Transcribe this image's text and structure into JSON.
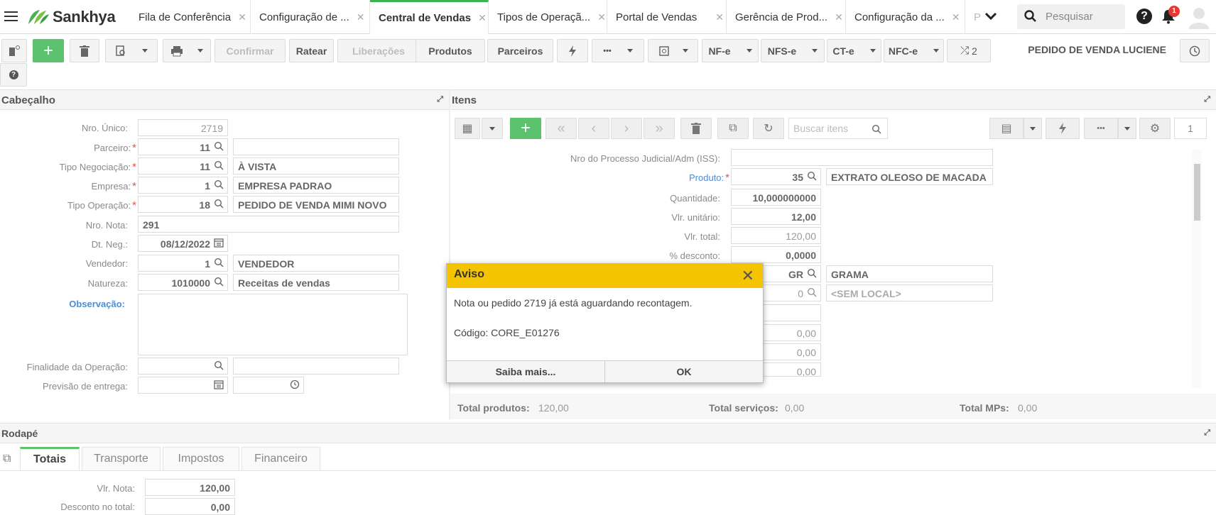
{
  "topbar": {
    "brand": "Sankhya",
    "tabs": [
      {
        "label": "Fila de Conferência",
        "active": false
      },
      {
        "label": "Configuração de ...",
        "active": false
      },
      {
        "label": "Central de Vendas",
        "active": true
      },
      {
        "label": "Tipos de Operaçã...",
        "active": false
      },
      {
        "label": "Portal de Vendas",
        "active": false
      },
      {
        "label": "Gerência de Prod...",
        "active": false
      },
      {
        "label": "Configuração da ...",
        "active": false
      },
      {
        "label": "P",
        "active": false
      }
    ],
    "search_placeholder": "Pesquisar",
    "notification_count": "1"
  },
  "toolbar": {
    "confirmar": "Confirmar",
    "ratear": "Ratear",
    "liberacoes": "Liberações",
    "produtos": "Produtos",
    "parceiros": "Parceiros",
    "more": "•••",
    "nfe": "NF-e",
    "nfse": "NFS-e",
    "cte": "CT-e",
    "nfce": "NFC-e",
    "shuffle_count": "2",
    "order_name": "PEDIDO DE VENDA LUCIENE"
  },
  "cabecalho": {
    "title": "Cabeçalho",
    "fields": {
      "nro_unico": {
        "label": "Nro. Único:",
        "value": "2719"
      },
      "parceiro": {
        "label": "Parceiro:",
        "code": "11",
        "desc": ""
      },
      "tipo_negociacao": {
        "label": "Tipo Negociação:",
        "code": "11",
        "desc": "À VISTA"
      },
      "empresa": {
        "label": "Empresa:",
        "code": "1",
        "desc": "EMPRESA PADRAO"
      },
      "tipo_operacao": {
        "label": "Tipo Operação:",
        "code": "18",
        "desc": "PEDIDO DE VENDA MIMI NOVO"
      },
      "nro_nota": {
        "label": "Nro. Nota:",
        "value": "291"
      },
      "dt_neg": {
        "label": "Dt. Neg.:",
        "value": "08/12/2022"
      },
      "vendedor": {
        "label": "Vendedor:",
        "code": "1",
        "desc": "VENDEDOR"
      },
      "natureza": {
        "label": "Natureza:",
        "code": "1010000",
        "desc": "Receitas de vendas"
      },
      "observacao": {
        "label": "Observação:",
        "value": ""
      },
      "finalidade": {
        "label": "Finalidade da Operação:",
        "value": ""
      },
      "previsao": {
        "label": "Previsão de entrega:",
        "value": ""
      }
    }
  },
  "itens": {
    "title": "Itens",
    "search_placeholder": "Buscar itens",
    "page": "1",
    "fields": {
      "processo": {
        "label": "Nro do Processo Judicial/Adm (ISS):",
        "value": ""
      },
      "produto": {
        "label": "Produto:",
        "code": "35",
        "desc": "EXTRATO OLEOSO DE MACADA"
      },
      "quantidade": {
        "label": "Quantidade:",
        "value": "10,000000000"
      },
      "vlr_unitario": {
        "label": "Vlr. unitário:",
        "value": "12,00"
      },
      "vlr_total": {
        "label": "Vlr. total:",
        "value": "120,00"
      },
      "desconto": {
        "label": "% desconto:",
        "value": "0,0000"
      },
      "unidade": {
        "code": "GR",
        "desc": "GRAMA"
      },
      "local": {
        "code": "0",
        "desc": "<SEM LOCAL>"
      },
      "z1": "0,00",
      "z2": "0,00",
      "z3": "0,00"
    },
    "totals": {
      "produtos_label": "Total produtos:",
      "produtos": "120,00",
      "servicos_label": "Total serviços:",
      "servicos": "0,00",
      "mps_label": "Total MPs:",
      "mps": "0,00"
    }
  },
  "modal": {
    "title": "Aviso",
    "message": "Nota ou pedido 2719 já está aguardando recontagem.",
    "code": "Código: CORE_E01276",
    "btn_more": "Saiba mais...",
    "btn_ok": "OK"
  },
  "rodape": {
    "title": "Rodapé",
    "tabs": [
      "Totais",
      "Transporte",
      "Impostos",
      "Financeiro"
    ],
    "vlr_nota_label": "Vlr. Nota:",
    "vlr_nota": "120,00",
    "desconto_label": "Desconto no total:",
    "desconto": "0,00"
  },
  "colors": {
    "accent": "#5cc26d",
    "warning": "#f5c400",
    "required": "#d9534f"
  }
}
